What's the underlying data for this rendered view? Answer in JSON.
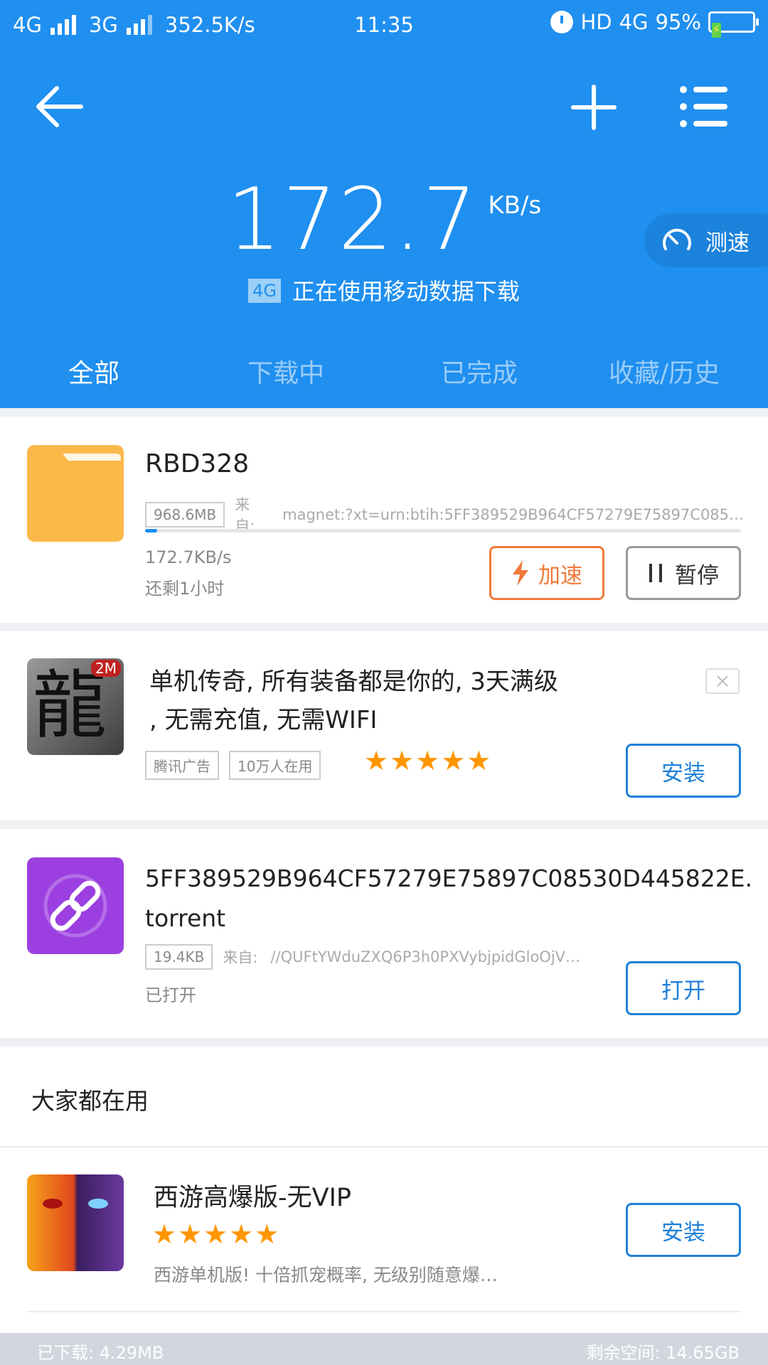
{
  "status_bar": {
    "net1": "4G",
    "net2": "3G",
    "net_speed": "352.5K/s",
    "time": "11:35",
    "hd": "HD",
    "net3": "4G",
    "battery": "95%"
  },
  "header": {
    "speed_value": "172.7",
    "speed_unit": "KB/s",
    "network_badge": "4G",
    "network_text": "正在使用移动数据下载",
    "speedtest_label": "测速"
  },
  "tabs": [
    "全部",
    "下载中",
    "已完成",
    "收藏/历史"
  ],
  "download_item": {
    "name": "RBD328",
    "size": "968.6MB",
    "source_label": "来自:",
    "source": "magnet:?xt=urn:btih:5FF389529B964CF57279E75897C085…",
    "progress": 0.02,
    "speed": "172.7KB/s",
    "remaining": "还剩1小时",
    "accelerate_label": "加速",
    "pause_label": "暂停"
  },
  "ad_item": {
    "title_line1": "单机传奇, 所有装备都是你的, 3天满级",
    "title_line2": ", 无需充值, 无需WIFI",
    "badge": "2M",
    "icon_char": "龍",
    "tag1": "腾讯广告",
    "tag2": "10万人在用",
    "stars": "★★★★★",
    "install_label": "安装"
  },
  "torrent_item": {
    "name_line1": "5FF389529B964CF57279E75897C08530D445822E.",
    "name_line2": "torrent",
    "size": "19.4KB",
    "source_label": "来自:",
    "source": "//QUFtYWduZXQ6P3h0PXVybjpidGloOjV…",
    "status": "已打开",
    "open_label": "打开"
  },
  "popular": {
    "section_title": "大家都在用",
    "app_name": "西游高爆版-无VIP",
    "stars": "★★★★★",
    "description": "西游单机版! 十倍抓宠概率, 无级别随意爆…",
    "install_label": "安装"
  },
  "footer": {
    "downloaded": "已下载: 4.29MB",
    "free_space": "剩余空间: 14.65GB"
  }
}
